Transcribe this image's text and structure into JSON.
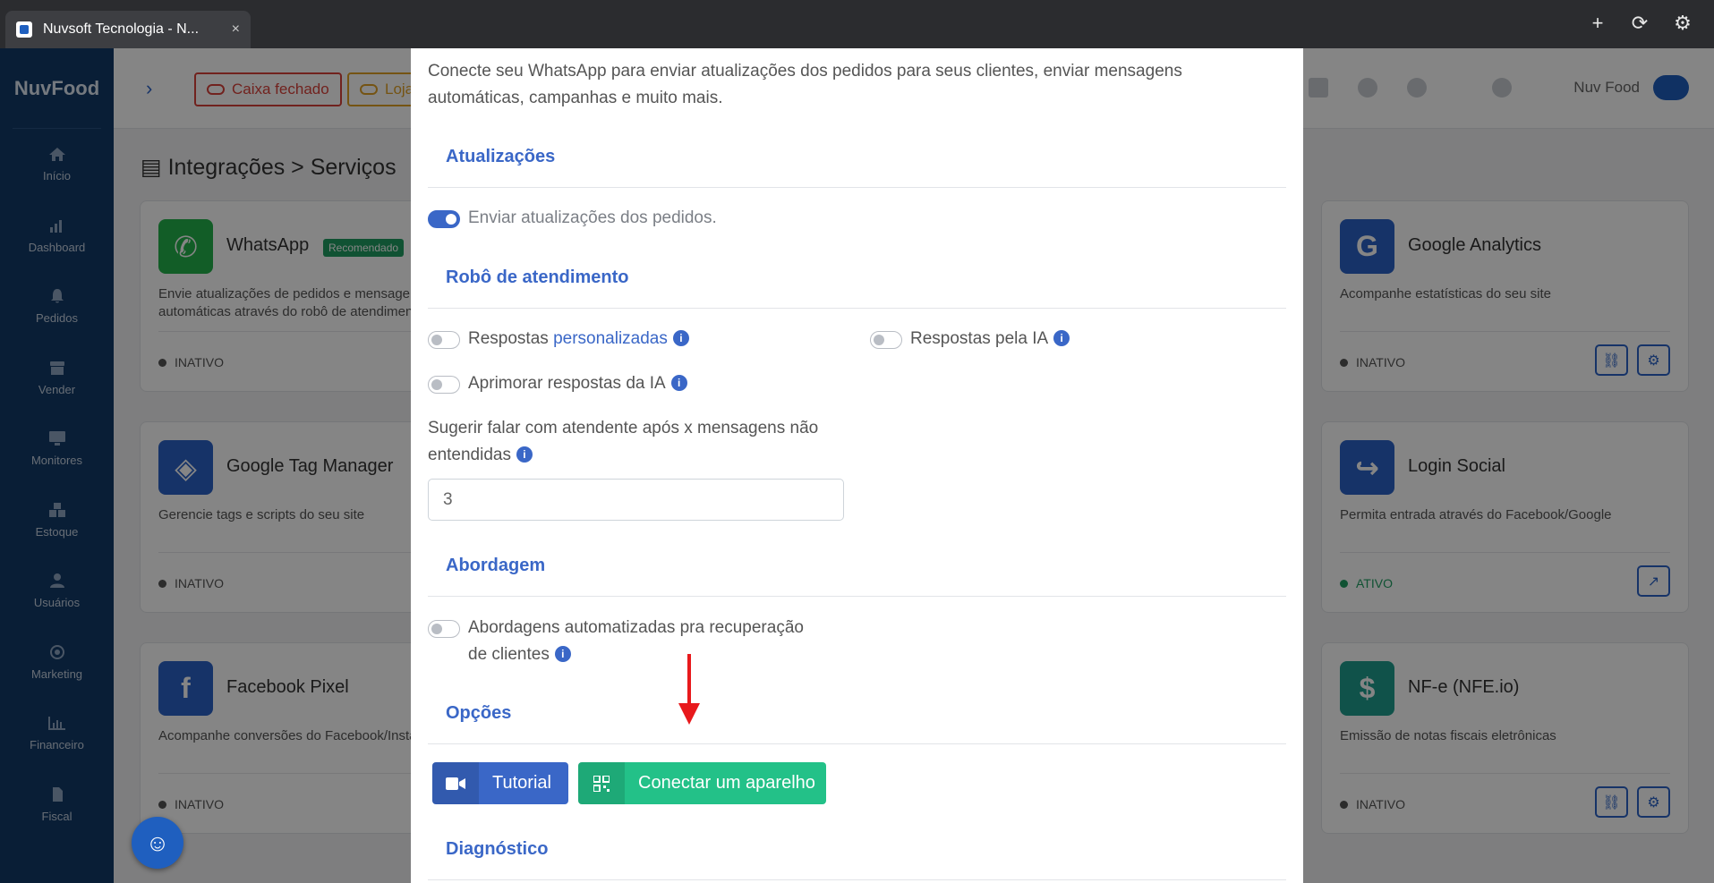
{
  "browser": {
    "tab_title": "Nuvsoft Tecnologia - N...",
    "tab_close": "×",
    "new_tab": "+",
    "reload": "⟳",
    "settings": "⚙"
  },
  "sidebar": {
    "brand": "NuvFood",
    "items": [
      {
        "label": "Início",
        "icon": "home-icon"
      },
      {
        "label": "Dashboard",
        "icon": "bar-chart-icon"
      },
      {
        "label": "Pedidos",
        "icon": "bell-icon"
      },
      {
        "label": "Vender",
        "icon": "store-icon"
      },
      {
        "label": "Monitores",
        "icon": "monitor-icon"
      },
      {
        "label": "Estoque",
        "icon": "boxes-icon"
      },
      {
        "label": "Usuários",
        "icon": "users-icon"
      },
      {
        "label": "Marketing",
        "icon": "target-icon"
      },
      {
        "label": "Financeiro",
        "icon": "chart-icon"
      },
      {
        "label": "Fiscal",
        "icon": "file-icon"
      }
    ]
  },
  "topbar": {
    "caixa": "Caixa fechado",
    "loja": "Loja",
    "user": "Nuv Food"
  },
  "page": {
    "title": "Integrações > Serviços"
  },
  "cards": {
    "whatsapp": {
      "title": "WhatsApp",
      "badge": "Recomendado",
      "desc": "Envie atualizações de pedidos e mensagens automáticas através do robô de atendimento",
      "status": "INATIVO"
    },
    "gtm": {
      "title": "Google Tag Manager",
      "desc": "Gerencie tags e scripts do seu site",
      "status": "INATIVO"
    },
    "fbpixel": {
      "title": "Facebook Pixel",
      "desc": "Acompanhe conversões do Facebook/Instagram",
      "status": "INATIVO"
    },
    "ga": {
      "title": "Google Analytics",
      "desc": "Acompanhe estatísticas do seu site",
      "status": "INATIVO"
    },
    "login": {
      "title": "Login Social",
      "desc": "Permita entrada através do Facebook/Google",
      "status": "ATIVO"
    },
    "nfe": {
      "title": "NF-e (NFE.io)",
      "desc": "Emissão de notas fiscais eletrônicas",
      "status": "INATIVO"
    }
  },
  "modal": {
    "intro": "Conecte seu WhatsApp para enviar atualizações dos pedidos para seus clientes, enviar mensagens automáticas, campanhas e muito mais.",
    "sections": {
      "atualizacoes": "Atualizações",
      "robo": "Robô de atendimento",
      "abordagem": "Abordagem",
      "opcoes": "Opções",
      "diagnostico": "Diagnóstico"
    },
    "toggles": {
      "enviar": {
        "label": "Enviar atualizações dos pedidos.",
        "on": true
      },
      "respostas_prefix": "Respostas",
      "respostas_link": "personalizadas",
      "respostas_ia": "Respostas pela IA",
      "aprimorar": "Aprimorar respostas da IA",
      "abordagens_line1": "Abordagens automatizadas pra recuperação",
      "abordagens_line2": "de clientes"
    },
    "sugerir_line1": "Sugerir falar com atendente após x mensagens não",
    "sugerir_line2": "entendidas",
    "sugerir_value": "3",
    "buttons": {
      "tutorial": "Tutorial",
      "conectar": "Conectar um aparelho"
    },
    "info_glyph": "i"
  }
}
